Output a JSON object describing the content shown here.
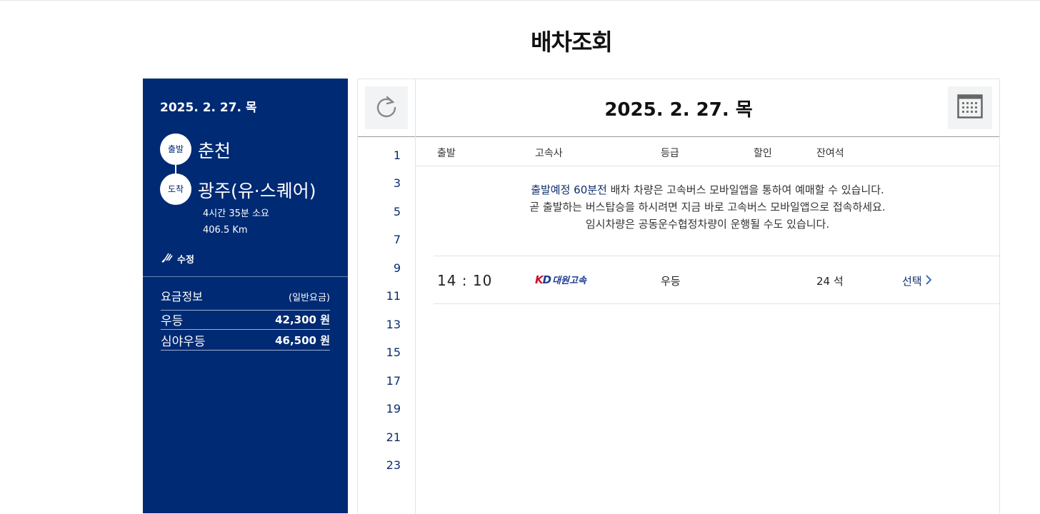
{
  "page": {
    "title": "배차조회"
  },
  "left_panel": {
    "date": "2025. 2. 27. 목",
    "departure_badge": "출발",
    "departure": "춘천",
    "arrival_badge": "도착",
    "arrival": "광주(유·스퀘어)",
    "duration": "4시간 35분 소요",
    "distance": "406.5 Km",
    "edit_label": "수정",
    "fare": {
      "title": "요금정보",
      "subtitle": "(일반요금)",
      "rows": [
        {
          "name": "우등",
          "price": "42,300 원"
        },
        {
          "name": "심야우등",
          "price": "46,500 원"
        }
      ]
    }
  },
  "right_panel": {
    "date": "2025. 2. 27. 목",
    "refresh_icon": "refresh-icon",
    "calendar_icon": "calendar-icon",
    "hours": [
      "1",
      "3",
      "5",
      "7",
      "9",
      "11",
      "13",
      "15",
      "17",
      "19",
      "21",
      "23"
    ],
    "columns": [
      "출발",
      "고속사",
      "등급",
      "할인",
      "잔여석"
    ],
    "notice": {
      "line1_highlight": "출발예정 60분전",
      "line1_rest": " 배차 차량은 고속버스 모바일앱을 통하여 예매할 수 있습니다.",
      "line2": "곧 출발하는 버스탑승을 하시려면 지금 바로 고속버스 모바일앱으로 접속하세요.",
      "line3": "임시차량은 공동운수협정차량이 운행될 수도 있습니다."
    },
    "results": [
      {
        "time": "14 : 10",
        "company_logo_text": "대원고속",
        "grade": "우등",
        "discount": "",
        "seats": "24 석",
        "select_label": "선택"
      }
    ]
  },
  "colors": {
    "navy": "#002a73",
    "link": "#0b2d6b"
  }
}
